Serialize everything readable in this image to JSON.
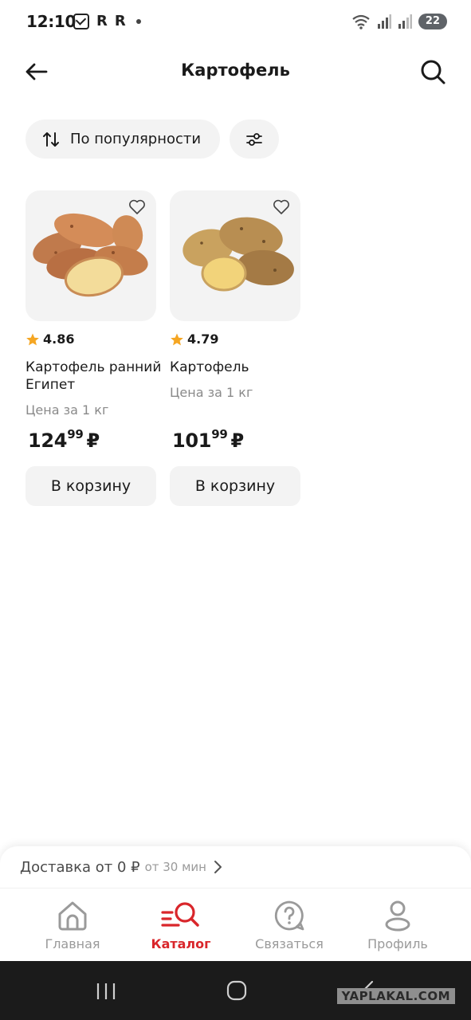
{
  "status_bar": {
    "time": "12:10",
    "notif_r1": "R",
    "notif_r2": "R",
    "battery": "22"
  },
  "header": {
    "title": "Картофель",
    "back_icon": "arrow-left-icon",
    "search_icon": "search-icon"
  },
  "filters": {
    "sort_label": "По популярности",
    "sort_icon": "sort-arrows-icon",
    "filter_icon": "sliders-icon"
  },
  "products": [
    {
      "rating": "4.86",
      "name": "Картофель ранний Египет",
      "unit": "Цена за 1 кг",
      "price_main": "124",
      "price_kop": "99",
      "currency": "₽",
      "cart_label": "В корзину"
    },
    {
      "rating": "4.79",
      "name": "Картофель",
      "unit": "Цена за 1 кг",
      "price_main": "101",
      "price_kop": "99",
      "currency": "₽",
      "cart_label": "В корзину"
    }
  ],
  "delivery": {
    "text": "Доставка от 0 ₽",
    "time": "от 30 мин"
  },
  "bottom_nav": {
    "items": [
      {
        "label": "Главная",
        "icon": "home-icon"
      },
      {
        "label": "Каталог",
        "icon": "catalog-search-icon",
        "active": true
      },
      {
        "label": "Связаться",
        "icon": "help-chat-icon"
      },
      {
        "label": "Профиль",
        "icon": "user-icon"
      }
    ]
  },
  "watermark": "YAPLAKAL.COM",
  "colors": {
    "accent": "#d9262b",
    "star": "#f5a623",
    "chip_bg": "#f3f3f3",
    "muted_text": "#8a8a8a"
  }
}
